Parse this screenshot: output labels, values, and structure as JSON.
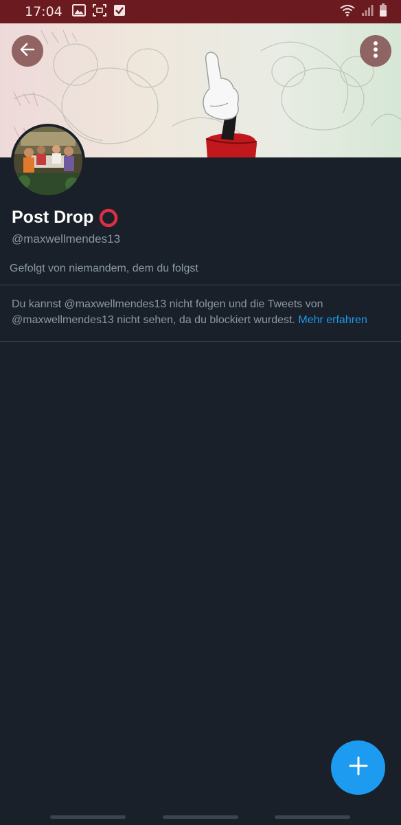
{
  "status_bar": {
    "time": "17:04",
    "left_icons": [
      "image-icon",
      "screenshot-icon",
      "checkbox-icon"
    ],
    "right_icons": [
      "wifi-icon",
      "signal-icon",
      "battery-icon"
    ]
  },
  "header": {
    "back_icon": "arrow-left-icon",
    "more_icon": "more-vertical-icon"
  },
  "profile": {
    "display_name": "Post Drop",
    "name_emoji": "⭕",
    "handle": "@maxwellmendes13",
    "followed_by": "Gefolgt von niemandem, dem du folgst"
  },
  "blocked_notice": {
    "text": "Du kannst @maxwellmendes13 nicht folgen und die Tweets von @maxwellmendes13 nicht sehen, da du blockiert wurdest.",
    "link_label": "Mehr erfahren"
  },
  "fab": {
    "icon": "plus-icon"
  },
  "colors": {
    "background": "#192029",
    "status_bar": "#6b1a1f",
    "accent": "#1d9bf0",
    "secondary_text": "#8b98a5",
    "divider": "#38444d"
  }
}
